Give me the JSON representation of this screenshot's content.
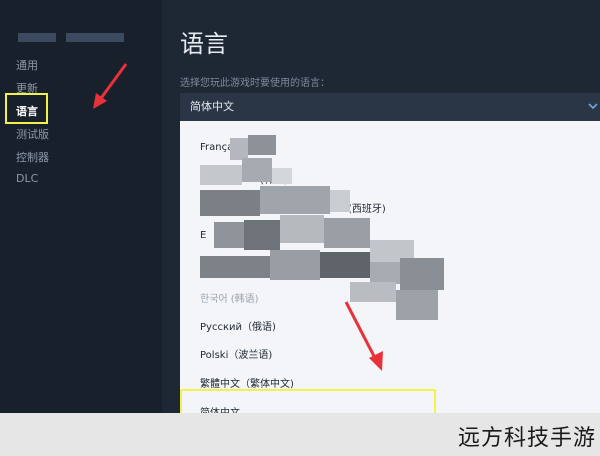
{
  "sidebar": {
    "items": [
      {
        "label": "通用"
      },
      {
        "label": "更新"
      },
      {
        "label": "语言"
      },
      {
        "label": "测试版"
      },
      {
        "label": "控制器"
      },
      {
        "label": "DLC"
      }
    ]
  },
  "main": {
    "title": "语言",
    "subtitle": "选择您玩此游戏时要使用的语言：",
    "select": {
      "value": "简体中文"
    },
    "options": [
      {
        "label": "Françai"
      },
      {
        "label": "(韩语)"
      },
      {
        "label": "(西班牙)"
      },
      {
        "label": "E"
      },
      {
        "label": "한국어 (韩语)"
      },
      {
        "label": "Русский（俄语)"
      },
      {
        "label": "Polski（波兰语)"
      },
      {
        "label": "繁體中文（繁体中文)"
      },
      {
        "label": "简体中文"
      }
    ]
  },
  "watermark": "远方科技手游",
  "colors": {
    "highlight": "#f2f24a",
    "arrow": "#e8323a"
  }
}
